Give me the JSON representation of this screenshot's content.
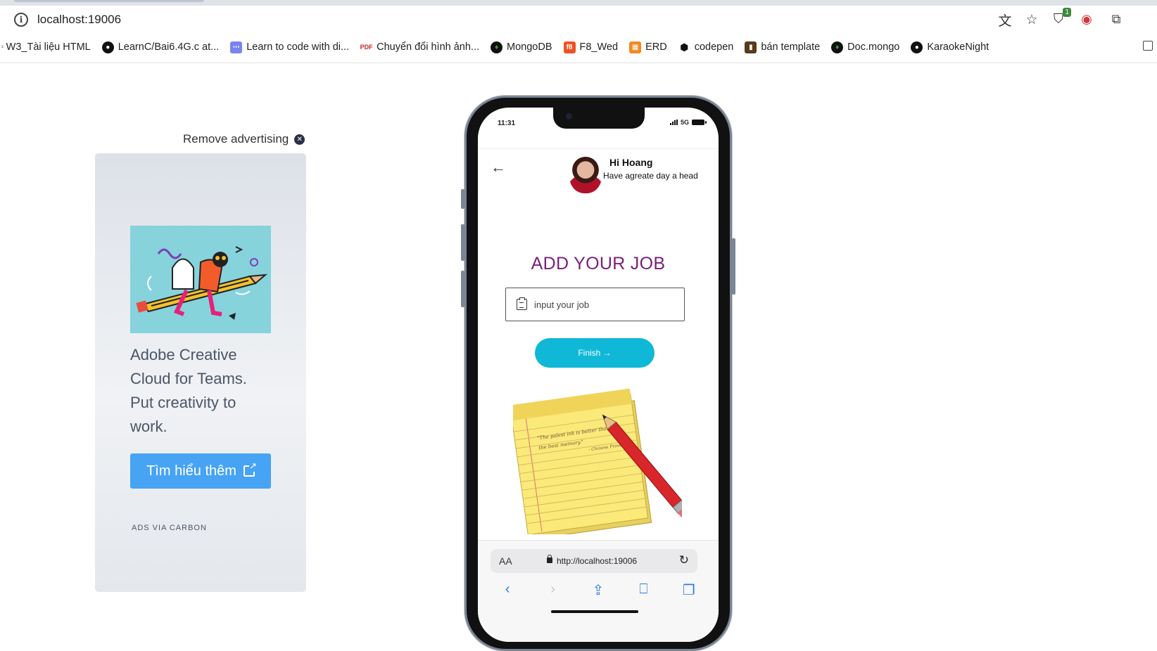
{
  "browser": {
    "url": "localhost:19006",
    "bookmarks": [
      {
        "label": "W3_Tài liệu HTML",
        "icon": "w3-icon"
      },
      {
        "label": "LearnC/Bai6.4G.c at...",
        "icon": "github-icon"
      },
      {
        "label": "Learn to code with di...",
        "icon": "discord-icon"
      },
      {
        "label": "Chuyển đổi hình ảnh...",
        "icon": "pdf24-icon"
      },
      {
        "label": "MongoDB",
        "icon": "mongodb-icon"
      },
      {
        "label": "F8_Wed",
        "icon": "f8-icon"
      },
      {
        "label": "ERD",
        "icon": "erd-icon"
      },
      {
        "label": "codepen",
        "icon": "codepen-icon"
      },
      {
        "label": "bán template",
        "icon": "template-icon"
      },
      {
        "label": "Doc.mongo",
        "icon": "mongodb-icon"
      },
      {
        "label": "KaraokeNight",
        "icon": "github-icon"
      }
    ]
  },
  "ad": {
    "remove_label": "Remove advertising",
    "text": "Adobe Creative Cloud for Teams. Put creativity to work.",
    "button_label": "Tìm hiểu thêm",
    "via_label": "ADS VIA CARBON",
    "image_icon": "illustration-pencil-rider"
  },
  "phone": {
    "status_time": "11:31",
    "network": "5G",
    "header": {
      "name": "Hi Hoang",
      "subtitle": "Have agreate day a head"
    },
    "title": "ADD YOUR JOB",
    "input_placeholder": "input your job",
    "finish_label": "Finish →",
    "safari": {
      "aa_label": "AA",
      "url": "http://localhost:19006"
    }
  },
  "colors": {
    "title": "#7a1f7a",
    "finish_button": "#0fb8d6",
    "ad_button": "#47a3f3"
  }
}
